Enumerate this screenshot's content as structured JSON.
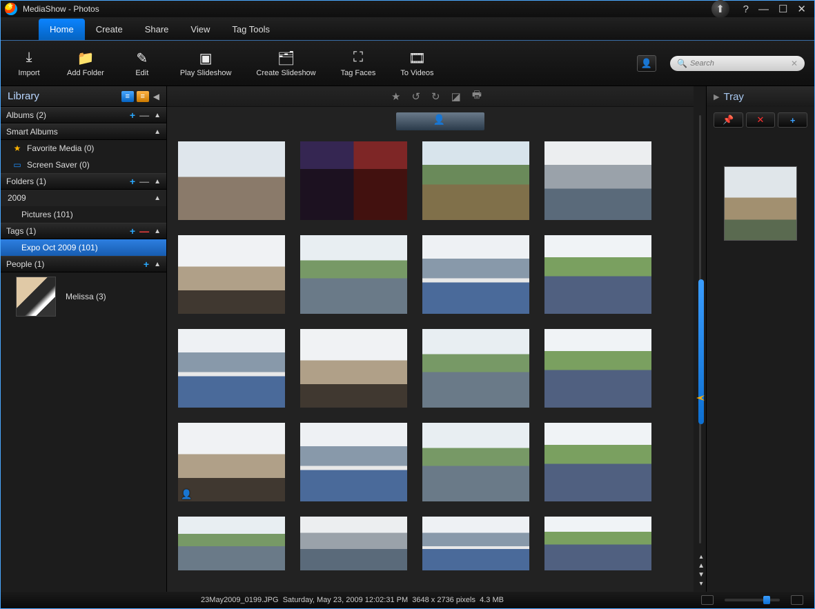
{
  "window": {
    "title": "MediaShow - Photos"
  },
  "menu": {
    "items": [
      "Home",
      "Create",
      "Share",
      "View",
      "Tag Tools"
    ],
    "active": 0
  },
  "toolbar": {
    "buttons": [
      {
        "label": "Import",
        "icon": "⤓"
      },
      {
        "label": "Add Folder",
        "icon": "📁"
      },
      {
        "label": "Edit",
        "icon": "✎"
      },
      {
        "label": "Play Slideshow",
        "icon": "▣"
      },
      {
        "label": "Create Slideshow",
        "icon": "🗂"
      },
      {
        "label": "Tag Faces",
        "icon": "⛶"
      },
      {
        "label": "To Videos",
        "icon": "🎞"
      }
    ]
  },
  "search": {
    "placeholder": "Search"
  },
  "library": {
    "title": "Library",
    "sections": {
      "albums": {
        "label": "Albums (2)"
      },
      "smart": {
        "label": "Smart Albums",
        "items": [
          "Favorite Media (0)",
          "Screen Saver (0)"
        ]
      },
      "folders": {
        "label": "Folders (1)",
        "year": "2009",
        "sub": "Pictures (101)"
      },
      "tags": {
        "label": "Tags (1)",
        "selected": "Expo Oct 2009 (101)"
      },
      "people": {
        "label": "People (1)",
        "person": "Melissa (3)"
      }
    }
  },
  "tray": {
    "title": "Tray"
  },
  "status": {
    "filename": "23May2009_0199.JPG",
    "date": "Saturday, May 23, 2009 12:02:31 PM",
    "dims": "3648 x 2736 pixels",
    "size": "4.3 MB"
  }
}
